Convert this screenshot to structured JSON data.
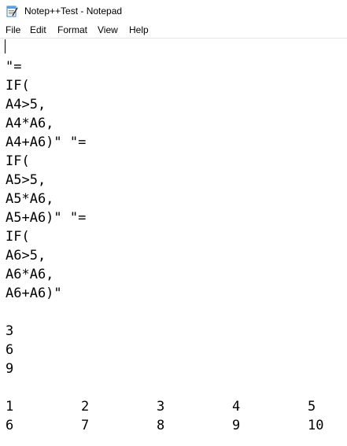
{
  "window": {
    "title": "Notep++Test - Notepad"
  },
  "menu": {
    "file": "File",
    "edit": "Edit",
    "format": "Format",
    "view": "View",
    "help": "Help"
  },
  "editor": {
    "lines": [
      "\"=",
      "IF(",
      "A4>5,",
      "A4*A6,",
      "A4+A6)\" \"=",
      "IF(",
      "A5>5,",
      "A5*A6,",
      "A5+A6)\" \"=",
      "IF(",
      "A6>5,",
      "A6*A6,",
      "A6+A6)\"",
      "3",
      "6",
      "9"
    ],
    "table_rows": [
      [
        "1",
        "2",
        "3",
        "4",
        "5"
      ],
      [
        "6",
        "7",
        "8",
        "9",
        "10"
      ]
    ]
  },
  "icons": {
    "app_icon": "notepad-icon"
  }
}
